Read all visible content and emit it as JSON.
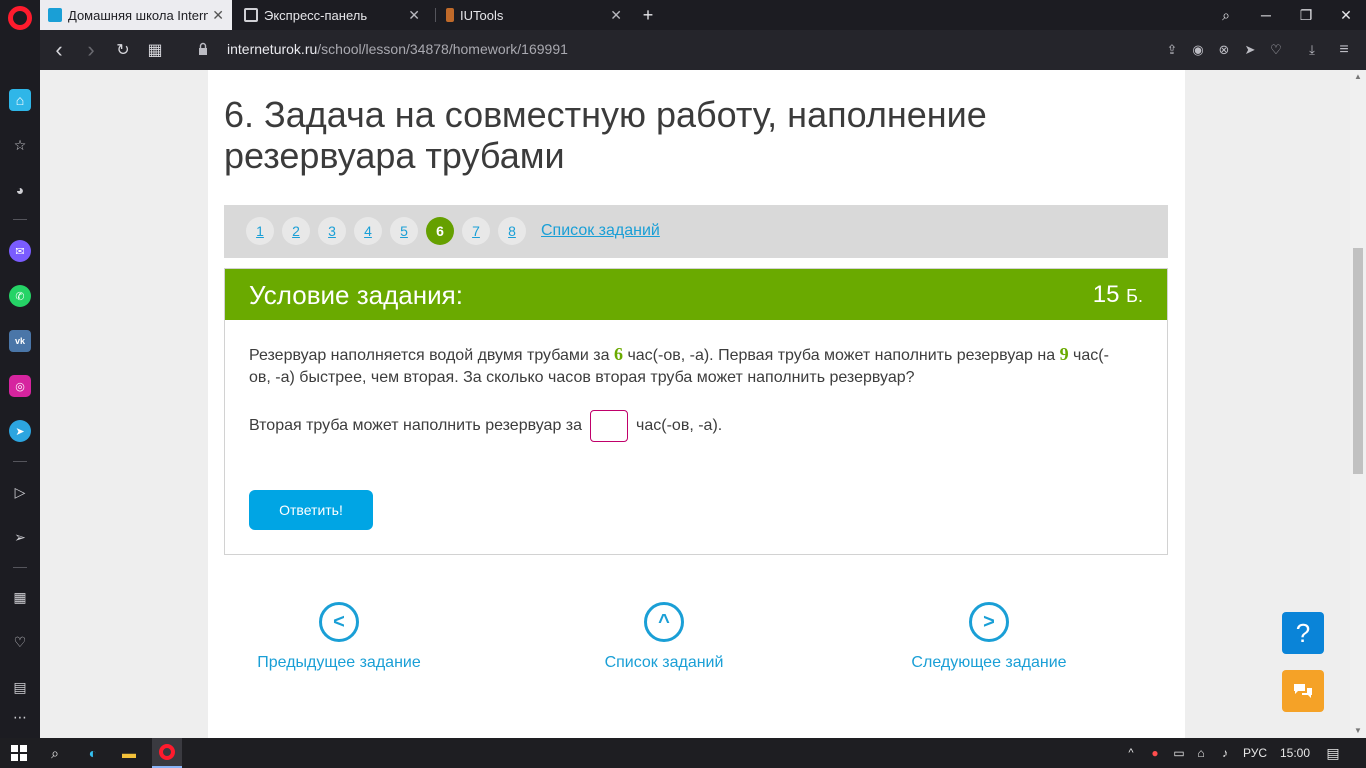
{
  "browser": {
    "tabs": [
      {
        "title": "Домашняя школа Internet",
        "active": true
      },
      {
        "title": "Экспресс-панель",
        "active": false
      },
      {
        "title": "IUTools",
        "active": false
      }
    ],
    "new_tab_symbol": "+",
    "url_host": "interneturok.ru",
    "url_path": "/school/lesson/34878/homework/169991"
  },
  "icons": {
    "back": "‹",
    "forward": "›",
    "reload": "↻",
    "grid": "▦",
    "search": "⌕",
    "minimize": "─",
    "maximize": "❐",
    "close": "✕",
    "share": "⇪",
    "camera": "◉",
    "block": "⊗",
    "send": "➤",
    "heart": "♡",
    "download": "⤓",
    "menu": "≡"
  },
  "lesson": {
    "title": "6. Задача на совместную работу, наполнение резервуара трубами"
  },
  "pager": {
    "pages": [
      "1",
      "2",
      "3",
      "4",
      "5",
      "6",
      "7",
      "8"
    ],
    "active_page": "6",
    "tasks_link": "Список заданий"
  },
  "task": {
    "header_title": "Условие задания:",
    "score": "15",
    "score_unit": "Б.",
    "text_part1": "Резервуар наполняется водой двумя трубами за",
    "num1": "6",
    "text_part2": "час(-ов, -а). Первая труба может наполнить резервуар на",
    "num2": "9",
    "text_part3": "час(-ов, -а) быстрее, чем вторая. За сколько часов вторая труба может наполнить резервуар?",
    "answer_prefix": "Вторая труба может наполнить резервуар за",
    "answer_value": "",
    "answer_suffix": "час(-ов, -а).",
    "submit_label": "Ответить!"
  },
  "bottom_nav": {
    "prev": "Предыдущее задание",
    "list": "Список заданий",
    "next": "Следующее задание"
  },
  "floating": {
    "help": "?"
  },
  "taskbar": {
    "language": "РУС",
    "time": "15:00"
  },
  "colors": {
    "accent_green": "#6aaa00",
    "active_page_green": "#65a000",
    "link_blue": "#1a9fd6",
    "button_blue": "#00a5e4",
    "help_blue": "#0a84d8",
    "chat_orange": "#f5a227",
    "input_border": "#c0006a"
  }
}
